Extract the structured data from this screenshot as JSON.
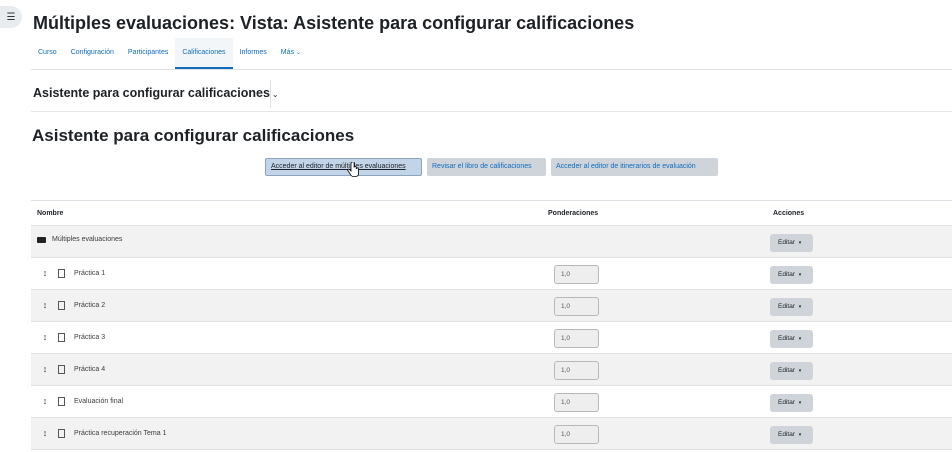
{
  "drawer": {
    "icon": "list-icon"
  },
  "page": {
    "title": "Múltiples evaluaciones: Vista: Asistente para configurar calificaciones"
  },
  "nav": {
    "tabs": [
      {
        "label": "Curso"
      },
      {
        "label": "Configuración"
      },
      {
        "label": "Participantes"
      },
      {
        "label": "Calificaciones",
        "active": true
      },
      {
        "label": "Informes"
      },
      {
        "label": "Más"
      }
    ],
    "more_chevron": "⌄"
  },
  "subheader": {
    "label": "Asistente para configurar calificaciones",
    "chevron": "⌄"
  },
  "section": {
    "title": "Asistente para configurar calificaciones"
  },
  "buttons": {
    "editor": "Acceder al editor de múltiples evaluaciones",
    "gradebook": "Revisar el libro de calificaciones",
    "itineraries": "Acceder al editor de itinerarios de evaluación"
  },
  "table": {
    "headers": {
      "name": "Nombre",
      "weights": "Ponderaciones",
      "actions": "Acciones"
    },
    "edit_label": "Editar",
    "category": {
      "name": "Múltiples evaluaciones"
    },
    "rows": [
      {
        "name": "Práctica 1",
        "weight": "1,0"
      },
      {
        "name": "Práctica 2",
        "weight": "1,0"
      },
      {
        "name": "Práctica 3",
        "weight": "1,0"
      },
      {
        "name": "Práctica 4",
        "weight": "1,0"
      },
      {
        "name": "Evaluación final",
        "weight": "1,0"
      },
      {
        "name": "Práctica recuperación Tema 1",
        "weight": "1,0"
      }
    ]
  },
  "colors": {
    "accent": "#0f6cbf",
    "button_bg": "#ced4da",
    "row_shade": "#f2f2f2"
  }
}
